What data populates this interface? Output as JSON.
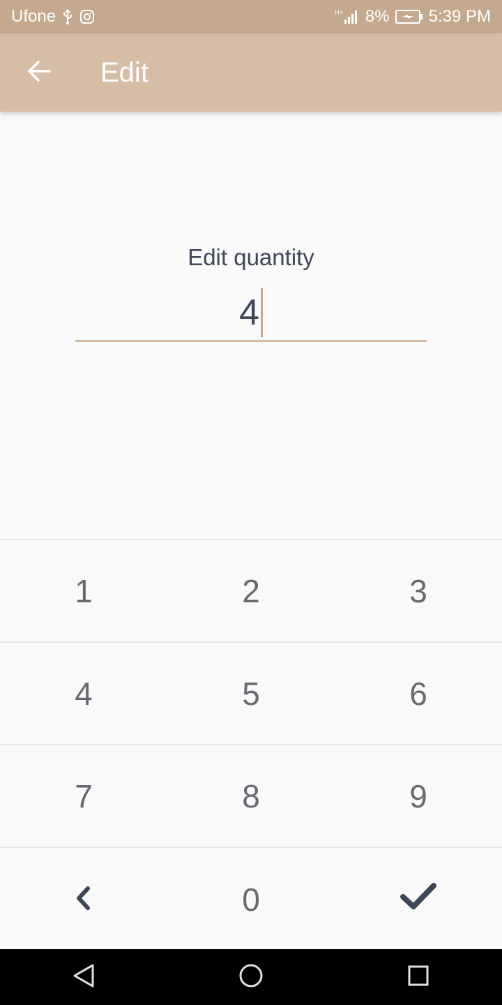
{
  "status_bar": {
    "carrier": "Ufone",
    "battery": "8%",
    "time": "5:39 PM",
    "icons": [
      "usb-icon",
      "instagram-icon",
      "signal-icon",
      "battery-charging-icon"
    ]
  },
  "app_bar": {
    "title": "Edit",
    "back_icon": "arrow-left-icon"
  },
  "form": {
    "label": "Edit quantity",
    "value": "4"
  },
  "keypad": {
    "rows": [
      [
        "1",
        "2",
        "3"
      ],
      [
        "4",
        "5",
        "6"
      ],
      [
        "7",
        "8",
        "9"
      ],
      [
        "backspace",
        "0",
        "confirm"
      ]
    ],
    "backspace_icon": "chevron-left-icon",
    "confirm_icon": "checkmark-icon"
  },
  "nav_bar": {
    "icons": [
      "back-triangle-icon",
      "home-circle-icon",
      "recents-square-icon"
    ]
  },
  "colors": {
    "status_bar": "#c4a990",
    "app_bar": "#d6bda8",
    "accent": "#d2bca4",
    "text_dark": "#3f4656",
    "key_text": "#666a70"
  }
}
